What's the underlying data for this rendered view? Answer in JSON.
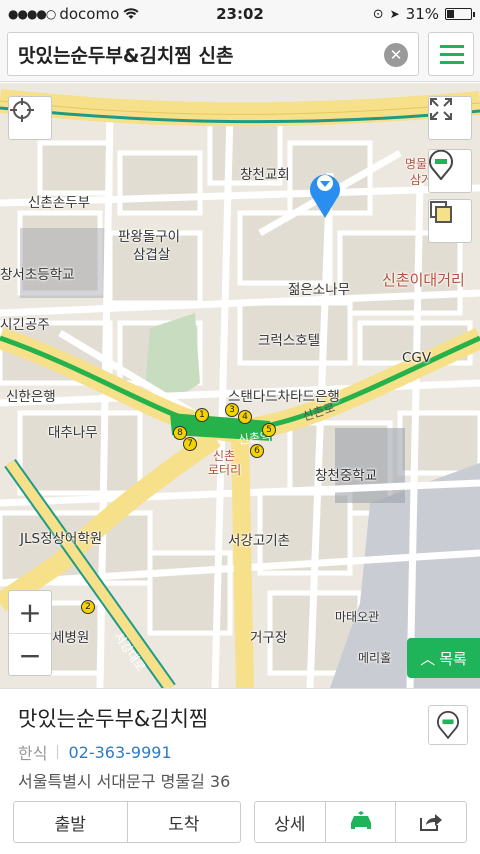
{
  "status_bar": {
    "carrier": "docomo",
    "time": "23:02",
    "battery": "31%",
    "battery_level": 0.31
  },
  "search": {
    "query": "맛있는순두부&김치찜 신촌",
    "clear_icon": "clear-icon",
    "menu_icon": "hamburger-menu-icon"
  },
  "map": {
    "labels": {
      "changcheon_church": "창천교회",
      "myeongmul": "명물",
      "samgeori": "삼거",
      "sinchon_sundubu": "신촌손두부",
      "panwang": "판왕돌구이",
      "samgyeopsal": "삼겹살",
      "changseo_school": "창서초등학교",
      "jeolmeun_sonamu": "젊은소나무",
      "sinchon_ideageori": "신촌이대거리",
      "gingongju": "시긴공주",
      "crux_hotel": "크럭스호텔",
      "cgv": "CGV",
      "shinhan_bank": "신한은행",
      "sc_bank": "스탠다드차타드은행",
      "sinchon_ro": "신촌로",
      "daechu_namu": "대추나무",
      "sinchon_station": "신촌역",
      "sinchon": "신촌",
      "rotary": "로터리",
      "changcheon_middle": "창천중학교",
      "jls": "JLS정상어학원",
      "seogang_gogi": "서강고기촌",
      "mattae_ogwan": "마태오관",
      "sebyeongwon": "세병원",
      "geoguljang": "거구장",
      "merihol": "메리홀",
      "seogang_daero": "서강대로"
    },
    "subway_exits": [
      "1",
      "2",
      "3",
      "4",
      "5",
      "6",
      "7",
      "8"
    ],
    "zoom_in": "+",
    "zoom_out": "−",
    "list_button": "목록",
    "colors": {
      "road_major": "#f6e08a",
      "road_minor": "#ffffff",
      "block": "#e3dfd5",
      "green_line": "#26b24a",
      "rail": "#1e9b86",
      "pin": "#2a8ef0"
    }
  },
  "place": {
    "name": "맛있는순두부&김치찜",
    "category": "한식",
    "phone": "02-363-9991",
    "address": "서울특별시 서대문구 명물길 36"
  },
  "actions": {
    "depart": "출발",
    "arrive": "도착",
    "details": "상세",
    "car_icon": "car-icon",
    "share_icon": "share-icon"
  }
}
